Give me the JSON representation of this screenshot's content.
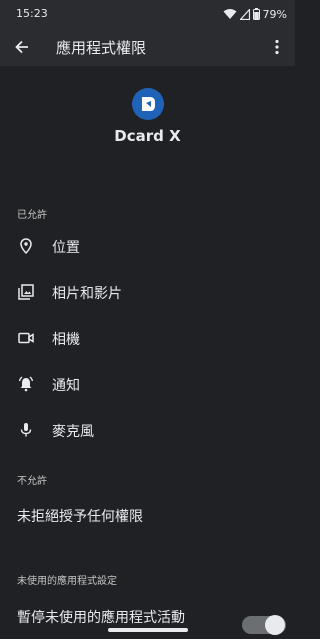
{
  "status_bar": {
    "time": "15:23",
    "battery": "79%"
  },
  "app_bar": {
    "title": "應用程式權限"
  },
  "app": {
    "name": "Dcard X"
  },
  "sections": {
    "allowed_header": "已允許",
    "not_allowed_header": "不允許",
    "unused_header": "未使用的應用程式設定"
  },
  "allowed_items": [
    {
      "label": "位置",
      "icon": "location-icon"
    },
    {
      "label": "相片和影片",
      "icon": "photo-icon"
    },
    {
      "label": "相機",
      "icon": "camera-icon"
    },
    {
      "label": "通知",
      "icon": "notification-bell-icon"
    },
    {
      "label": "麥克風",
      "icon": "microphone-icon"
    }
  ],
  "not_allowed_text": "未拒絕授予任何權限",
  "unused_setting": {
    "label": "暫停未使用的應用程式活動",
    "toggle_on": true
  },
  "colors": {
    "background": "#202124",
    "appbar": "#2b2c2f",
    "app_icon": "#1e63b8"
  }
}
